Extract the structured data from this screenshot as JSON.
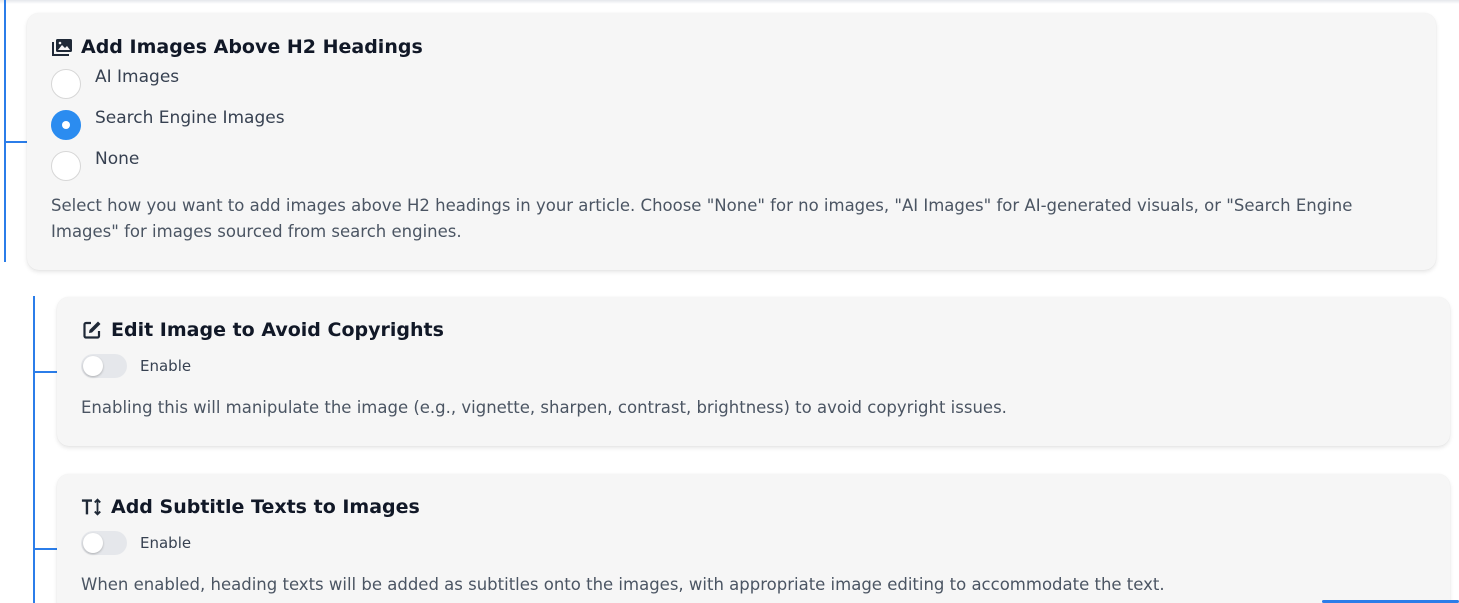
{
  "image_above_h2": {
    "title": "Add Images Above H2 Headings",
    "icon": "images-icon",
    "options": [
      {
        "label": "AI Images",
        "checked": false
      },
      {
        "label": "Search Engine Images",
        "checked": true
      },
      {
        "label": "None",
        "checked": false
      }
    ],
    "description": "Select how you want to add images above H2 headings in your article. Choose \"None\" for no images, \"AI Images\" for AI-generated visuals, or \"Search Engine Images\" for images sourced from search engines."
  },
  "edit_image": {
    "title": "Edit Image to Avoid Copyrights",
    "icon": "edit-icon",
    "toggle_label": "Enable",
    "enabled": false,
    "description": "Enabling this will manipulate the image (e.g., vignette, sharpen, contrast, brightness) to avoid copyright issues."
  },
  "subtitle_texts": {
    "title": "Add Subtitle Texts to Images",
    "icon": "text-height-icon",
    "toggle_label": "Enable",
    "enabled": false,
    "description": "When enabled, heading texts will be added as subtitles onto the images, with appropriate image editing to accommodate the text."
  },
  "colors": {
    "accent": "#2b8cf0",
    "tree_line": "#2b7de9",
    "card_bg": "#f6f6f6"
  }
}
